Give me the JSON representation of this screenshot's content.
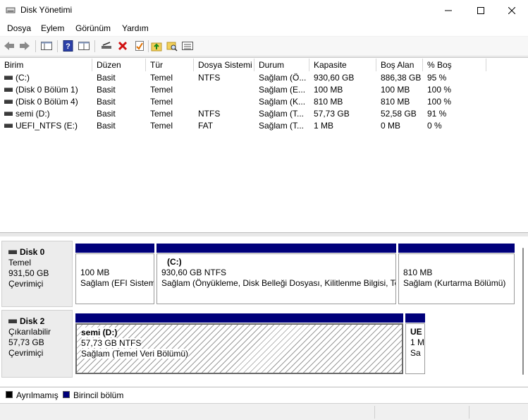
{
  "window": {
    "title": "Disk Yönetimi"
  },
  "menu": [
    "Dosya",
    "Eylem",
    "Görünüm",
    "Yardım"
  ],
  "toolbar": [
    "back-icon",
    "forward-icon",
    "console-tree-icon",
    "help-icon",
    "properties-icon",
    "connect-icon",
    "delete-icon",
    "checklist-icon",
    "folder-up-icon",
    "folder-search-icon",
    "details-view-icon"
  ],
  "volumes": {
    "columns": [
      "Birim",
      "Düzen",
      "Tür",
      "Dosya Sistemi",
      "Durum",
      "Kapasite",
      "Boş Alan",
      "% Boş"
    ],
    "rows": [
      [
        "(C:)",
        "Basit",
        "Temel",
        "NTFS",
        "Sağlam (Ö...",
        "930,60 GB",
        "886,38 GB",
        "95 %"
      ],
      [
        "(Disk 0 Bölüm 1)",
        "Basit",
        "Temel",
        "",
        "Sağlam (E...",
        "100 MB",
        "100 MB",
        "100 %"
      ],
      [
        "(Disk 0 Bölüm 4)",
        "Basit",
        "Temel",
        "",
        "Sağlam (K...",
        "810 MB",
        "810 MB",
        "100 %"
      ],
      [
        "semi (D:)",
        "Basit",
        "Temel",
        "NTFS",
        "Sağlam (T...",
        "57,73 GB",
        "52,58 GB",
        "91 %"
      ],
      [
        "UEFI_NTFS (E:)",
        "Basit",
        "Temel",
        "FAT",
        "Sağlam (T...",
        "1 MB",
        "0 MB",
        "0 %"
      ]
    ]
  },
  "disks": [
    {
      "name": "Disk 0",
      "type": "Temel",
      "size": "931,50 GB",
      "status": "Çevrimiçi",
      "partitions": [
        {
          "label": "",
          "size": "100 MB",
          "status": "Sağlam (EFI Sistem"
        },
        {
          "label": "(C:)",
          "size": "930,60 GB NTFS",
          "status": "Sağlam (Önyükleme, Disk Belleği Dosyası, Kilitlenme Bilgisi, Te"
        },
        {
          "label": "",
          "size": "810 MB",
          "status": "Sağlam (Kurtarma Bölümü)"
        }
      ]
    },
    {
      "name": "Disk 2",
      "type": "Çıkarılabilir",
      "size": "57,73 GB",
      "status": "Çevrimiçi",
      "partitions": [
        {
          "label": "semi  (D:)",
          "size": "57,73 GB NTFS",
          "status": "Sağlam (Temel Veri Bölümü)"
        },
        {
          "label": "UE",
          "size": "1 M",
          "status": "Sa"
        }
      ]
    }
  ],
  "legend": [
    {
      "label": "Ayrılmamış",
      "color": "#000000"
    },
    {
      "label": "Birincil bölüm",
      "color": "#00007a"
    }
  ]
}
